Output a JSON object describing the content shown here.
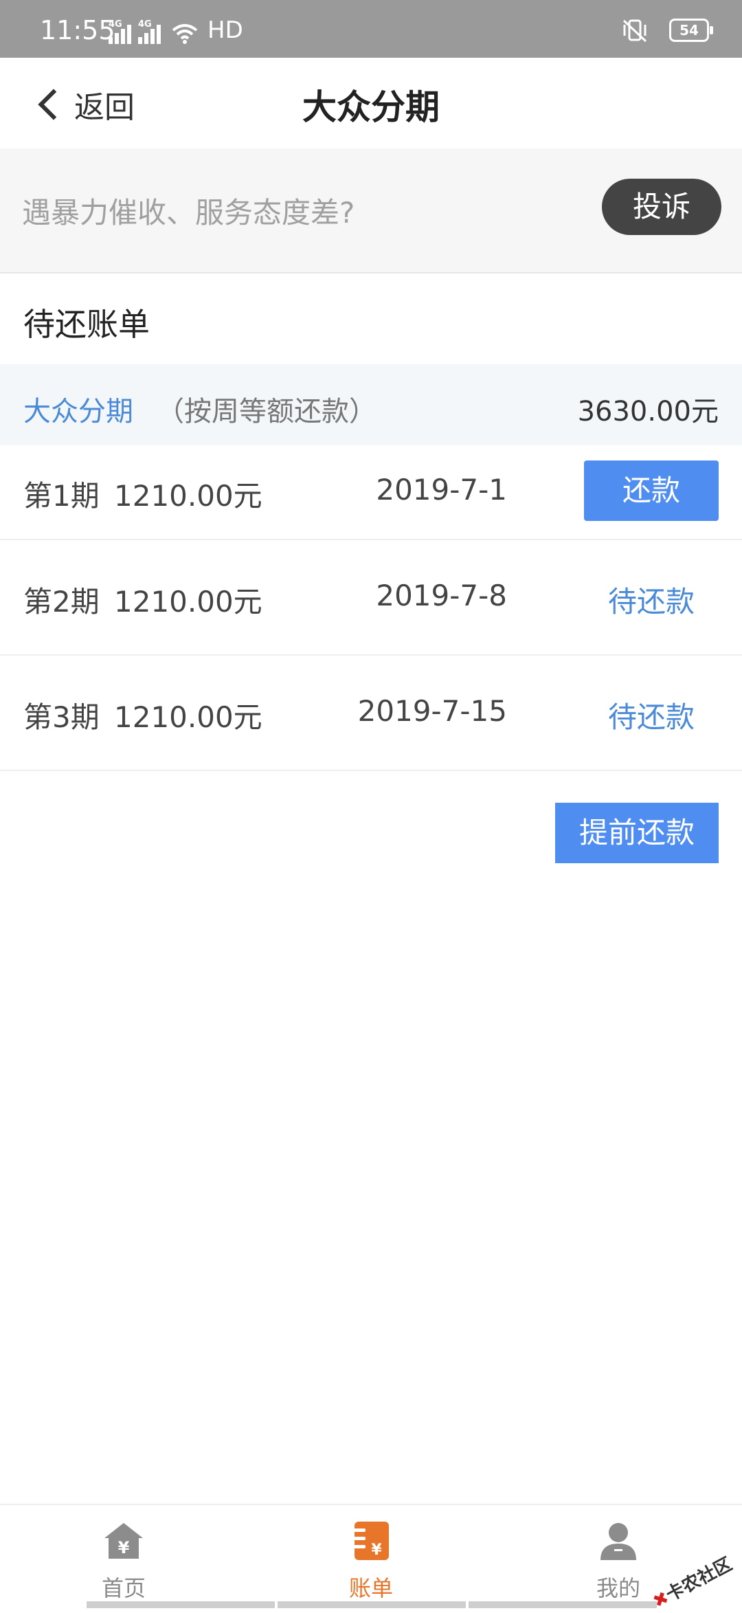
{
  "status_bar": {
    "time": "11:55",
    "net1": "4G",
    "net2": "4G",
    "hd": "HD",
    "battery": "54"
  },
  "nav": {
    "back_label": "返回",
    "title": "大众分期"
  },
  "complaint": {
    "text": "遇暴力催收、服务态度差?",
    "button": "投诉"
  },
  "bills": {
    "section_title": "待还账单",
    "product_name": "大众分期",
    "product_note": "（按周等额还款）",
    "product_total": "3630.00元",
    "installments": [
      {
        "period": "第1期",
        "amount": "1210.00元",
        "date": "2019-7-1",
        "action": "还款"
      },
      {
        "period": "第2期",
        "amount": "1210.00元",
        "date": "2019-7-8",
        "action": "待还款"
      },
      {
        "period": "第3期",
        "amount": "1210.00元",
        "date": "2019-7-15",
        "action": "待还款"
      }
    ],
    "prepay_button": "提前还款"
  },
  "tabbar": {
    "items": [
      {
        "label": "首页",
        "icon": "home-yen-icon"
      },
      {
        "label": "账单",
        "icon": "bill-icon"
      },
      {
        "label": "我的",
        "icon": "user-icon"
      }
    ],
    "active": "账单",
    "active_color": "#e8762a"
  },
  "watermark": "卡农社区",
  "colors": {
    "accent_blue": "#4f8ef0",
    "link_blue": "#4a8ad6",
    "complaint_button": "#444444"
  }
}
